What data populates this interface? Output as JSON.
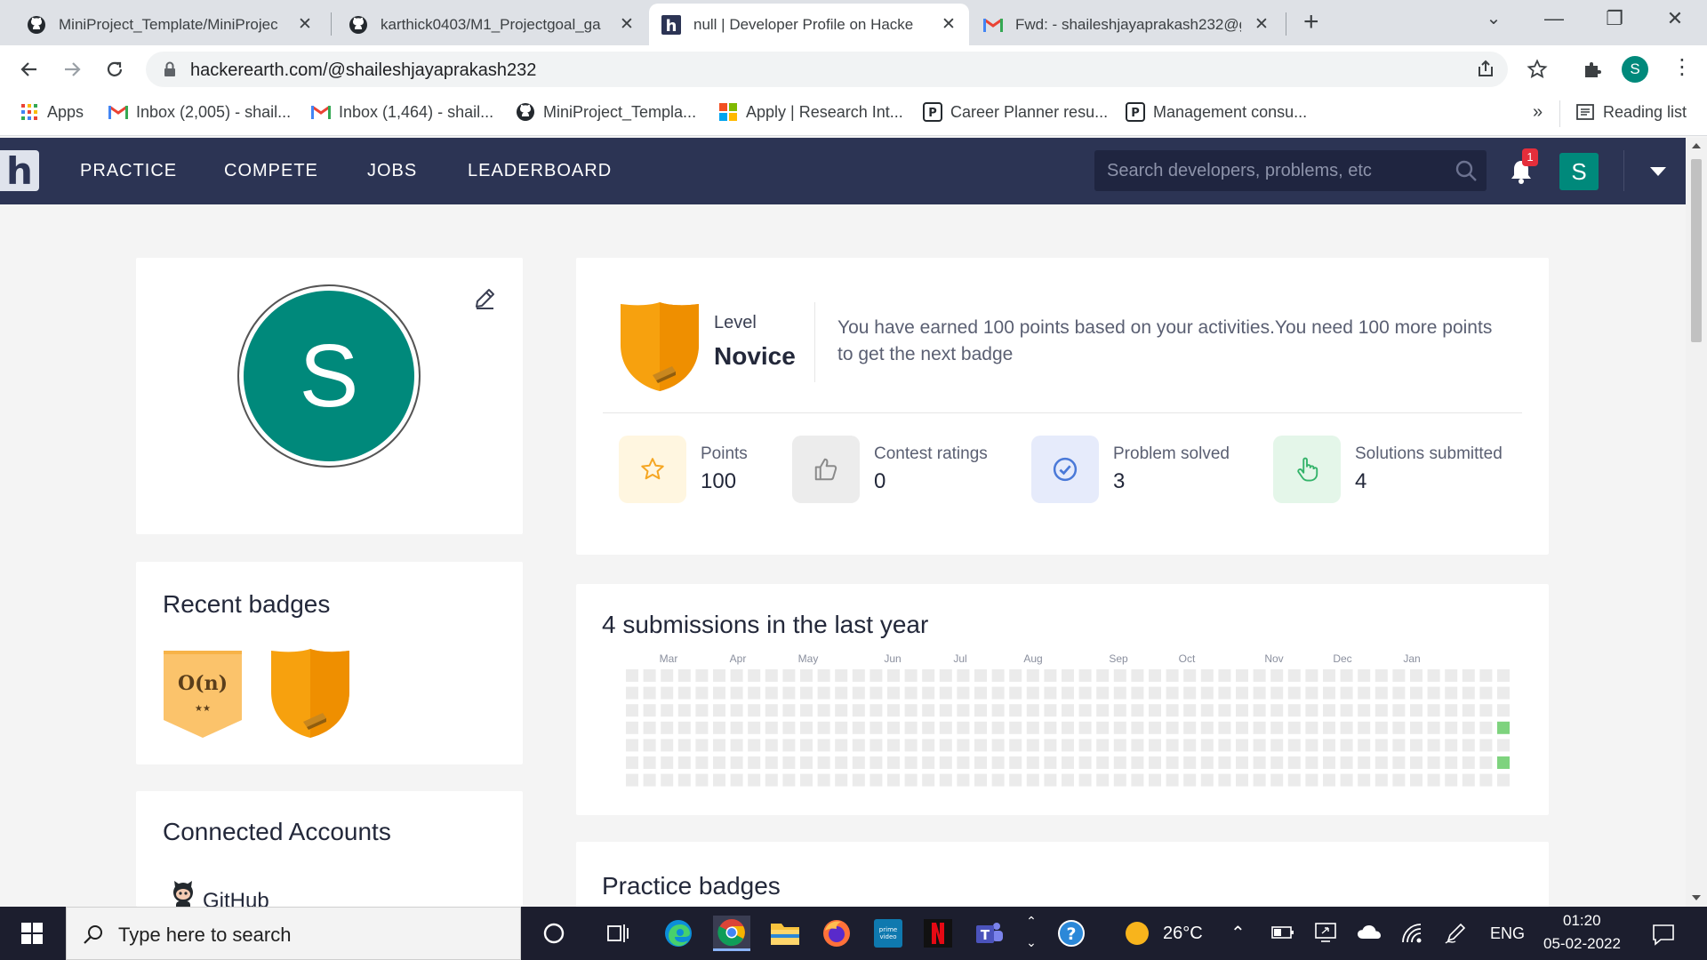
{
  "browser": {
    "tabs": [
      {
        "title": "MiniProject_Template/MiniProjec",
        "icon": "github-icon"
      },
      {
        "title": "karthick0403/M1_Projectgoal_ga",
        "icon": "github-icon"
      },
      {
        "title": "null | Developer Profile on Hacke",
        "icon": "hackerearth-icon"
      },
      {
        "title": "Fwd: - shaileshjayaprakash232@g",
        "icon": "gmail-icon"
      }
    ],
    "url": "hackerearth.com/@shaileshjayaprakash232",
    "profile_initial": "S",
    "bookmarks": [
      {
        "label": "Apps",
        "icon": "apps-grid-icon"
      },
      {
        "label": "Inbox (2,005) - shail...",
        "icon": "gmail-icon"
      },
      {
        "label": "Inbox (1,464) - shail...",
        "icon": "gmail-icon"
      },
      {
        "label": "MiniProject_Templa...",
        "icon": "github-icon"
      },
      {
        "label": "Apply | Research Int...",
        "icon": "microsoft-icon"
      },
      {
        "label": "Career Planner resu...",
        "icon": "p-icon"
      },
      {
        "label": "Management consu...",
        "icon": "p-icon"
      }
    ],
    "bookmarks_overflow": "»",
    "reading_list": "Reading list"
  },
  "hackerearth": {
    "logo": "h",
    "nav": [
      "PRACTICE",
      "COMPETE",
      "JOBS",
      "LEADERBOARD"
    ],
    "search_placeholder": "Search developers, problems, etc",
    "notification_count": "1",
    "avatar_initial": "S"
  },
  "profile": {
    "avatar_initial": "S"
  },
  "recent_badges": {
    "title": "Recent badges",
    "badge1_text": "O(n)",
    "badge1_stars": "★★"
  },
  "connected_accounts": {
    "title": "Connected Accounts",
    "github": "GitHub"
  },
  "level": {
    "label": "Level",
    "name": "Novice",
    "message": "You have earned 100 points based on your activities.You need 100 more points to get the next badge"
  },
  "stats": [
    {
      "label": "Points",
      "value": "100",
      "icon": "star-icon",
      "bg": "#fff6e0",
      "fg": "#f5a623"
    },
    {
      "label": "Contest ratings",
      "value": "0",
      "icon": "thumbs-up-icon",
      "bg": "#ececec",
      "fg": "#8a8a8a"
    },
    {
      "label": "Problem solved",
      "value": "3",
      "icon": "check-circle-icon",
      "bg": "#e6ebfb",
      "fg": "#4a79d8"
    },
    {
      "label": "Solutions submitted",
      "value": "4",
      "icon": "hand-pointer-icon",
      "bg": "#e4f6e9",
      "fg": "#34b36a"
    }
  ],
  "submissions": {
    "title": "4 submissions in the last year",
    "months": [
      "Mar",
      "Apr",
      "May",
      "Jun",
      "Jul",
      "Aug",
      "Sep",
      "Oct",
      "Nov",
      "Dec",
      "Jan"
    ],
    "weeks": 51,
    "days": 7,
    "active_cells": [
      {
        "week": 50,
        "day": 3
      },
      {
        "week": 50,
        "day": 5
      }
    ],
    "empty_color": "#ebebeb",
    "active_color": "#7ed37e"
  },
  "practice_badges": {
    "title": "Practice badges"
  },
  "taskbar": {
    "search_placeholder": "Type here to search",
    "temperature": "26°C",
    "language": "ENG",
    "time": "01:20",
    "date": "05-02-2022"
  },
  "colors": {
    "nav_bg": "#2c3454",
    "teal": "#00897b",
    "shield_orange": "#f7a10e"
  }
}
